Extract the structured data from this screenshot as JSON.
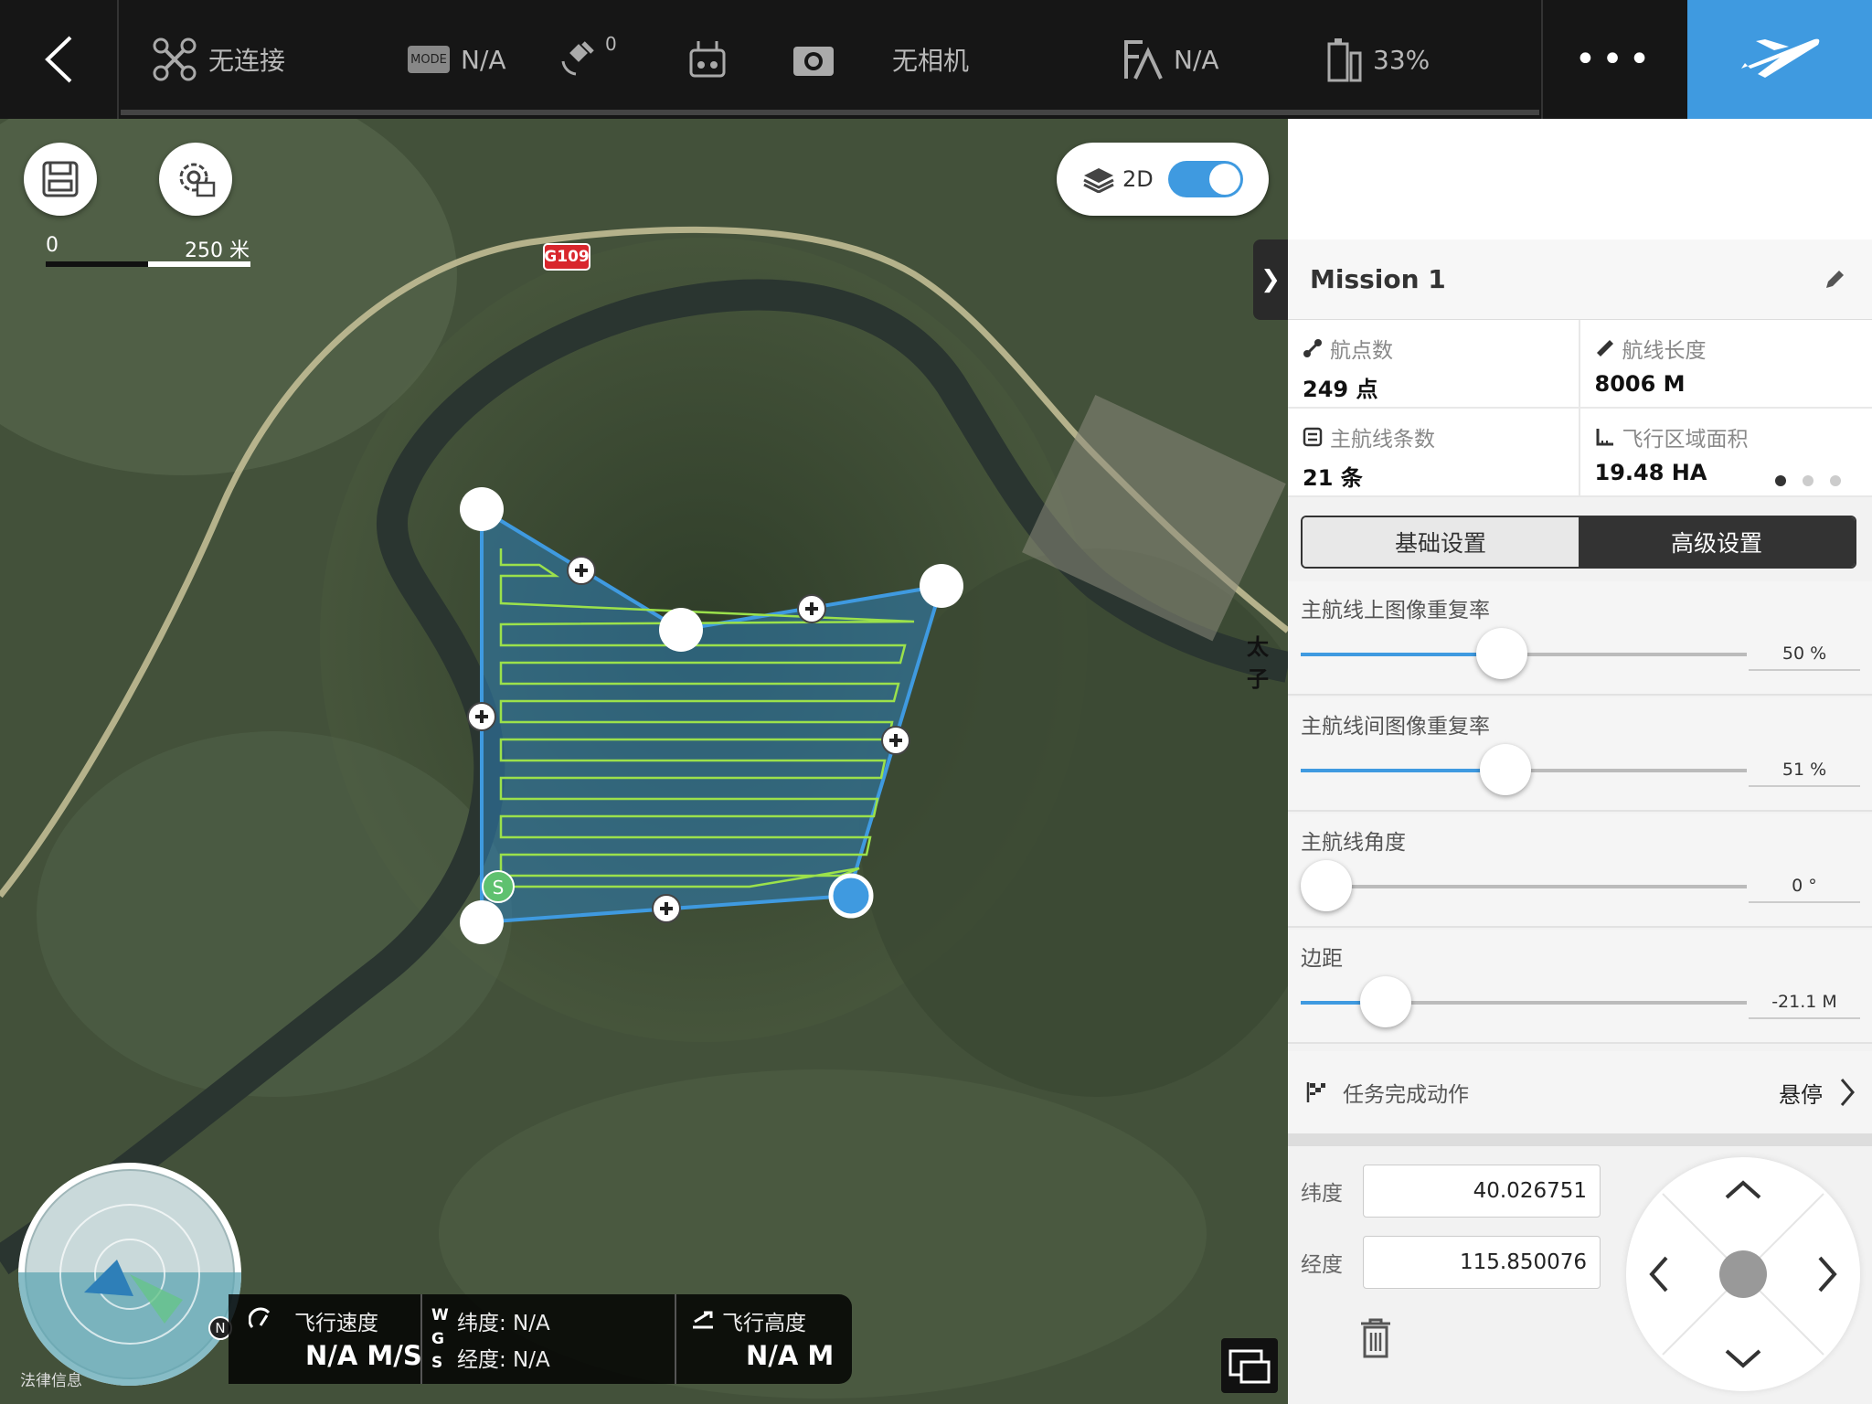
{
  "topbar": {
    "connection": "无连接",
    "mode_badge": "MODE",
    "mode_value": "N/A",
    "satellite_count": "0",
    "camera": "无相机",
    "signal": "N/A",
    "battery": "33%"
  },
  "map": {
    "view_label": "2D",
    "scale_zero": "0",
    "scale_value": "250 米",
    "road_label": "G109",
    "place_label": "太子",
    "legal": "法律信息"
  },
  "mission": {
    "title": "Mission 1",
    "stats": [
      {
        "label": "航点数",
        "value": "249 点"
      },
      {
        "label": "航线长度",
        "value": "8006 M"
      },
      {
        "label": "主航线条数",
        "value": "21 条"
      },
      {
        "label": "飞行区域面积",
        "value": "19.48 HA"
      }
    ],
    "tab_basic": "基础设置",
    "tab_advanced": "高级设置",
    "sliders": [
      {
        "label": "主航线上图像重复率",
        "value": "50 %",
        "fraction": 0.45
      },
      {
        "label": "主航线间图像重复率",
        "value": "51 %",
        "fraction": 0.46
      },
      {
        "label": "主航线角度",
        "value": "0 °",
        "fraction": 0.0
      },
      {
        "label": "边距",
        "value": "-21.1 M",
        "fraction": 0.19
      }
    ],
    "finish_action_label": "任务完成动作",
    "finish_action_value": "悬停",
    "latitude_label": "纬度",
    "latitude_value": "40.026751",
    "longitude_label": "经度",
    "longitude_value": "115.850076"
  },
  "telemetry": {
    "speed_label": "飞行速度",
    "speed_value": "N/A M/S",
    "wgs": "W G S",
    "lat": "纬度: N/A",
    "lon": "经度: N/A",
    "alt_label": "飞行高度",
    "alt_value": "N/A M",
    "compass_north": "N"
  },
  "colors": {
    "accent": "#3f9ae0",
    "route": "#9be14b",
    "area": "#2e7fb8"
  }
}
